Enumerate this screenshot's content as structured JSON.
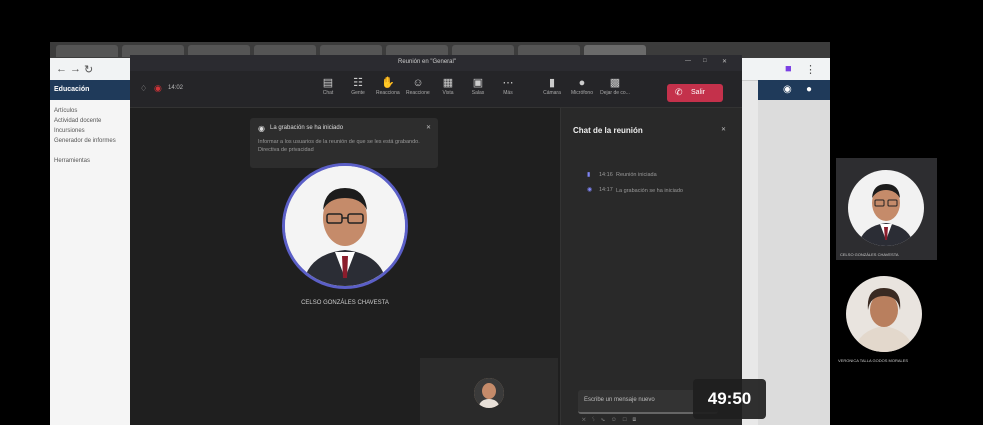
{
  "browser": {
    "sidebar_title": "Educación",
    "sidebar_items": [
      "Artículos",
      "Actividad docente",
      "Incursiones",
      "Generador de informes",
      "Herramientas"
    ]
  },
  "teams": {
    "window_title": "Reunión en \"General\"",
    "call_duration": "14:02",
    "toolbar": [
      {
        "icon": "chat-icon",
        "label": "Chat"
      },
      {
        "icon": "people-icon",
        "label": "Gente"
      },
      {
        "icon": "raise-hand-icon",
        "label": "Reaccionar"
      },
      {
        "icon": "reaction-icon",
        "label": "Reacciones"
      },
      {
        "icon": "view-icon",
        "label": "Vista"
      },
      {
        "icon": "rooms-icon",
        "label": "Salas"
      },
      {
        "icon": "more-icon",
        "label": "Más"
      },
      {
        "icon": "camera-icon",
        "label": "Cámara"
      },
      {
        "icon": "mic-icon",
        "label": "Micrófono"
      },
      {
        "icon": "share-icon",
        "label": "Dejar de co..."
      }
    ],
    "leave_label": "Salir",
    "recording_notice": {
      "title": "La grabación se ha iniciado",
      "body": "Informar a los usuarios de la reunión de que se les está grabando. Directiva de privacidad"
    },
    "speaker_name": "CELSO GONZÁLES CHAVESTA",
    "chat": {
      "title": "Chat de la reunión",
      "messages": [
        {
          "time": "14:16",
          "text": "Reunión iniciada"
        },
        {
          "time": "14:17",
          "text": "La grabación se ha iniciado"
        }
      ],
      "input_placeholder": "Escribe un mensaje nuevo"
    }
  },
  "participants": [
    {
      "name": "CELSO GONZÁLES CHAVESTA"
    },
    {
      "name": "VERONICA TALLA GODOS MORALES"
    }
  ],
  "video_timestamp": "49:50"
}
